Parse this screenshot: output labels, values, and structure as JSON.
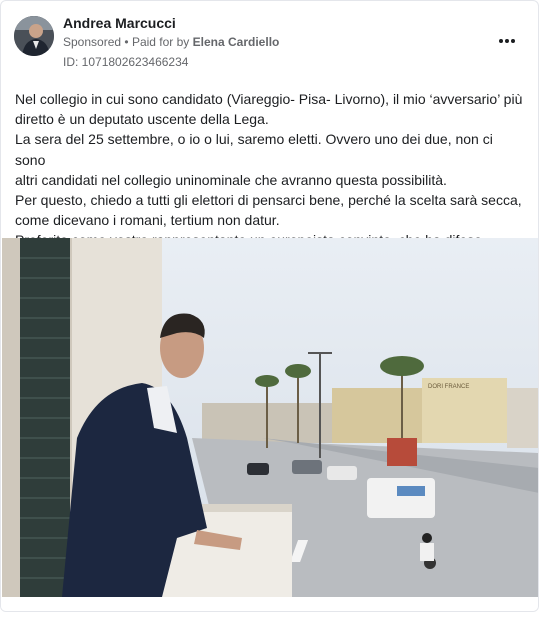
{
  "post": {
    "author": "Andrea Marcucci",
    "sponsored": "Sponsored",
    "separator": "•",
    "paid_for_prefix": "Paid for by",
    "paid_for_name": "Elena Cardiello",
    "ad_id": "ID: 1071802623466234",
    "more_icon": "more-horizontal-icon",
    "text_lines": [
      "Nel collegio in cui sono candidato (Viareggio- Pisa- Livorno), il mio ‘avversario’ più",
      "diretto è un deputato uscente della Lega.",
      "La sera del 25 settembre, o io o lui, saremo eletti. Ovvero uno dei due, non ci sono",
      "altri candidati nel collegio uninominale che avranno questa possibilità.",
      "Per questo, chiedo a tutti gli elettori di pensarci bene, perché la scelta sarà secca,",
      "come dicevano i romani, tertium non datur.",
      "Preferite come vostro rappresentante un europeista convinto, che ha difeso…"
    ],
    "photo_sign": "DORI FRANCE"
  },
  "colors": {
    "text": "#1c1e21",
    "secondary": "#65676b",
    "border": "#e4e6eb",
    "sky": "#dfe6ee",
    "shutter": "#2f3d3a"
  }
}
